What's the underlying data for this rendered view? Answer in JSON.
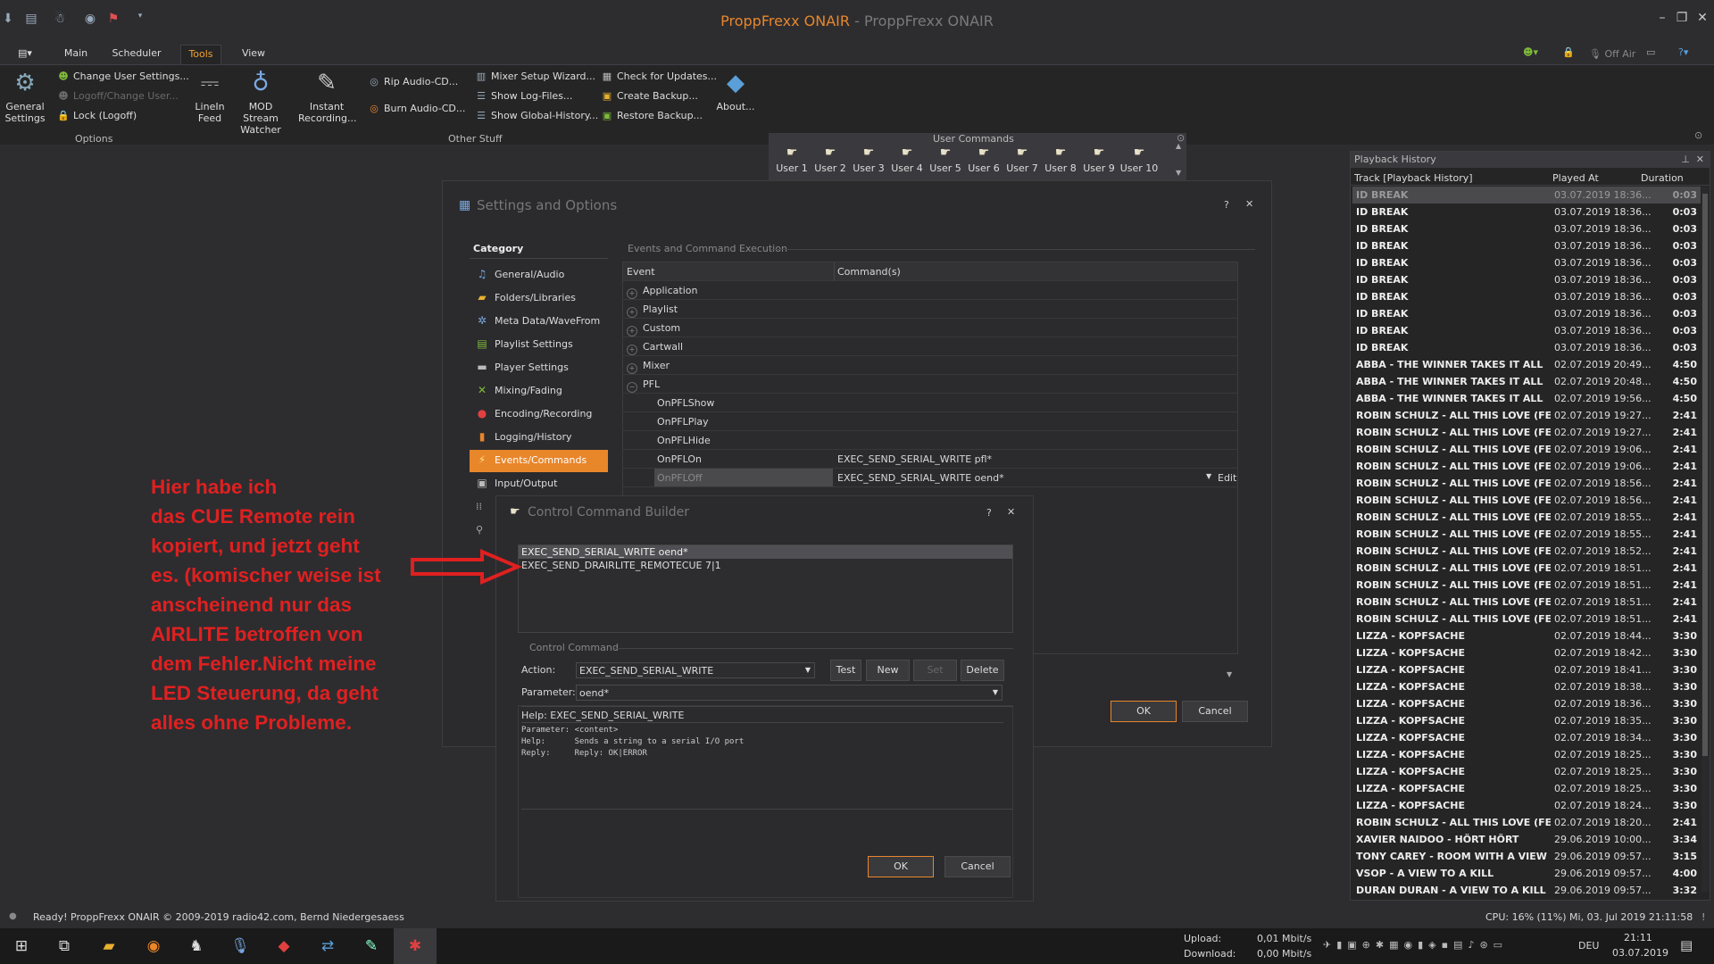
{
  "window": {
    "title_app": "ProppFrexx ONAIR",
    "title_sep": " - ",
    "title_sub": "ProppFrexx ONAIR"
  },
  "tabs": [
    "Main",
    "Scheduler",
    "Tools",
    "View"
  ],
  "active_tab": "Tools",
  "ribbon": {
    "general_settings": "General Settings",
    "change_user": "Change User Settings...",
    "logoff_change": "Logoff/Change User...",
    "lock": "Lock (Logoff)",
    "options_group": "Options",
    "linein_feed": "LineIn Feed",
    "mod_stream": "MOD Stream Watcher",
    "instant_recording": "Instant Recording...",
    "rip_audio": "Rip Audio-CD...",
    "burn_audio": "Burn Audio-CD...",
    "mixer_setup": "Mixer Setup Wizard...",
    "show_log": "Show Log-Files...",
    "show_global": "Show Global-History...",
    "check_updates": "Check for Updates...",
    "create_backup": "Create Backup...",
    "restore_backup": "Restore Backup...",
    "about": "About...",
    "other_group": "Other Stuff",
    "user_buttons": [
      "User 1",
      "User 2",
      "User 3",
      "User 4",
      "User 5",
      "User 6",
      "User 7",
      "User 8",
      "User 9",
      "User 10"
    ],
    "user_group": "User Commands",
    "off_air": "Off Air"
  },
  "settings": {
    "title": "Settings and Options",
    "category_header": "Category",
    "categories": [
      "General/Audio",
      "Folders/Libraries",
      "Meta Data/WaveFrom",
      "Playlist Settings",
      "Player Settings",
      "Mixing/Fading",
      "Encoding/Recording",
      "Logging/History",
      "Events/Commands",
      "Input/Output"
    ],
    "selected_category": "Events/Commands",
    "section_title": "Events and Command Execution",
    "col_event": "Event",
    "col_commands": "Command(s)",
    "groups": [
      "Application",
      "Playlist",
      "Custom",
      "Cartwall",
      "Mixer",
      "PFL"
    ],
    "events": [
      {
        "name": "OnPFLShow",
        "cmd": ""
      },
      {
        "name": "OnPFLPlay",
        "cmd": ""
      },
      {
        "name": "OnPFLHide",
        "cmd": ""
      },
      {
        "name": "OnPFLOn",
        "cmd": "EXEC_SEND_SERIAL_WRITE pfl*"
      },
      {
        "name": "OnPFLOff",
        "cmd": "EXEC_SEND_SERIAL_WRITE oend*"
      }
    ],
    "edit_btn": "Edit",
    "ok": "OK",
    "cancel": "Cancel"
  },
  "builder": {
    "title": "Control Command Builder",
    "commands": [
      "EXEC_SEND_SERIAL_WRITE oend*",
      "EXEC_SEND_DRAIRLITE_REMOTECUE 7|1"
    ],
    "section": "Control Command",
    "action_label": "Action:",
    "action_value": "EXEC_SEND_SERIAL_WRITE",
    "test": "Test",
    "new": "New",
    "set": "Set",
    "delete": "Delete",
    "param_label": "Parameter:",
    "param_value": "oend*",
    "help_title": "Help: EXEC_SEND_SERIAL_WRITE",
    "help_body": "Parameter: <content>\nHelp:      Sends a string to a serial I/O port\nReply:     Reply: OK|ERROR",
    "ok": "OK",
    "cancel": "Cancel"
  },
  "annotation": [
    "Hier habe ich",
    "das CUE Remote rein",
    "kopiert, und jetzt geht",
    "es. (komischer weise ist",
    "anscheinend nur das",
    "AIRLITE betroffen von",
    "dem Fehler.Nicht meine",
    "LED Steuerung, da geht",
    "alles ohne Probleme."
  ],
  "history": {
    "title": "Playback History",
    "col_track": "Track [Playback History]",
    "col_played": "Played At",
    "col_duration": "Duration",
    "rows": [
      [
        "ID BREAK",
        "03.07.2019 18:36...",
        "0:03"
      ],
      [
        "ID BREAK",
        "03.07.2019 18:36...",
        "0:03"
      ],
      [
        "ID BREAK",
        "03.07.2019 18:36...",
        "0:03"
      ],
      [
        "ID BREAK",
        "03.07.2019 18:36...",
        "0:03"
      ],
      [
        "ID BREAK",
        "03.07.2019 18:36...",
        "0:03"
      ],
      [
        "ID BREAK",
        "03.07.2019 18:36...",
        "0:03"
      ],
      [
        "ID BREAK",
        "03.07.2019 18:36...",
        "0:03"
      ],
      [
        "ID BREAK",
        "03.07.2019 18:36...",
        "0:03"
      ],
      [
        "ID BREAK",
        "03.07.2019 18:36...",
        "0:03"
      ],
      [
        "ID BREAK",
        "03.07.2019 18:36...",
        "0:03"
      ],
      [
        "ABBA - THE WINNER TAKES IT ALL",
        "02.07.2019 20:49...",
        "4:50"
      ],
      [
        "ABBA - THE WINNER TAKES IT ALL",
        "02.07.2019 20:48...",
        "4:50"
      ],
      [
        "ABBA - THE WINNER TAKES IT ALL",
        "02.07.2019 19:56...",
        "4:50"
      ],
      [
        "ROBIN SCHULZ - ALL THIS LOVE (FE...",
        "02.07.2019 19:27...",
        "2:41"
      ],
      [
        "ROBIN SCHULZ - ALL THIS LOVE (FE...",
        "02.07.2019 19:27...",
        "2:41"
      ],
      [
        "ROBIN SCHULZ - ALL THIS LOVE (FE...",
        "02.07.2019 19:06...",
        "2:41"
      ],
      [
        "ROBIN SCHULZ - ALL THIS LOVE (FE...",
        "02.07.2019 19:06...",
        "2:41"
      ],
      [
        "ROBIN SCHULZ - ALL THIS LOVE (FE...",
        "02.07.2019 18:56...",
        "2:41"
      ],
      [
        "ROBIN SCHULZ - ALL THIS LOVE (FE...",
        "02.07.2019 18:56...",
        "2:41"
      ],
      [
        "ROBIN SCHULZ - ALL THIS LOVE (FE...",
        "02.07.2019 18:55...",
        "2:41"
      ],
      [
        "ROBIN SCHULZ - ALL THIS LOVE (FE...",
        "02.07.2019 18:55...",
        "2:41"
      ],
      [
        "ROBIN SCHULZ - ALL THIS LOVE (FE...",
        "02.07.2019 18:52...",
        "2:41"
      ],
      [
        "ROBIN SCHULZ - ALL THIS LOVE (FE...",
        "02.07.2019 18:51...",
        "2:41"
      ],
      [
        "ROBIN SCHULZ - ALL THIS LOVE (FE...",
        "02.07.2019 18:51...",
        "2:41"
      ],
      [
        "ROBIN SCHULZ - ALL THIS LOVE (FE...",
        "02.07.2019 18:51...",
        "2:41"
      ],
      [
        "ROBIN SCHULZ - ALL THIS LOVE (FE...",
        "02.07.2019 18:51...",
        "2:41"
      ],
      [
        "LIZZA - KOPFSACHE",
        "02.07.2019 18:44...",
        "3:30"
      ],
      [
        "LIZZA - KOPFSACHE",
        "02.07.2019 18:42...",
        "3:30"
      ],
      [
        "LIZZA - KOPFSACHE",
        "02.07.2019 18:41...",
        "3:30"
      ],
      [
        "LIZZA - KOPFSACHE",
        "02.07.2019 18:38...",
        "3:30"
      ],
      [
        "LIZZA - KOPFSACHE",
        "02.07.2019 18:36...",
        "3:30"
      ],
      [
        "LIZZA - KOPFSACHE",
        "02.07.2019 18:35...",
        "3:30"
      ],
      [
        "LIZZA - KOPFSACHE",
        "02.07.2019 18:34...",
        "3:30"
      ],
      [
        "LIZZA - KOPFSACHE",
        "02.07.2019 18:25...",
        "3:30"
      ],
      [
        "LIZZA - KOPFSACHE",
        "02.07.2019 18:25...",
        "3:30"
      ],
      [
        "LIZZA - KOPFSACHE",
        "02.07.2019 18:25...",
        "3:30"
      ],
      [
        "LIZZA - KOPFSACHE",
        "02.07.2019 18:24...",
        "3:30"
      ],
      [
        "ROBIN SCHULZ - ALL THIS LOVE (FE...",
        "02.07.2019 18:20...",
        "2:41"
      ],
      [
        "XAVIER NAIDOO - HÖRT HÖRT",
        "29.06.2019 10:00...",
        "3:34"
      ],
      [
        "TONY CAREY - ROOM WITH A VIEW",
        "29.06.2019 09:57...",
        "3:15"
      ],
      [
        "VSOP - A VIEW TO A KILL",
        "29.06.2019 09:57...",
        "4:00"
      ],
      [
        "DURAN DURAN - A VIEW TO A KILL",
        "29.06.2019 09:57...",
        "3:32"
      ]
    ]
  },
  "status": {
    "text": "Ready!  ProppFrexx ONAIR © 2009-2019 radio42.com, Bernd Niedergesaess",
    "right": "CPU: 16% (11%)    Mi, 03. Jul 2019 21:11:58"
  },
  "taskbar": {
    "upload_label": "Upload:",
    "upload_value": "0,01 Mbit/s",
    "download_label": "Download:",
    "download_value": "0,00 Mbit/s",
    "lang": "DEU",
    "time": "21:11",
    "date": "03.07.2019"
  },
  "colors": {
    "accent": "#e8862a",
    "annotation": "#e02020",
    "background": "#2d2d30"
  }
}
